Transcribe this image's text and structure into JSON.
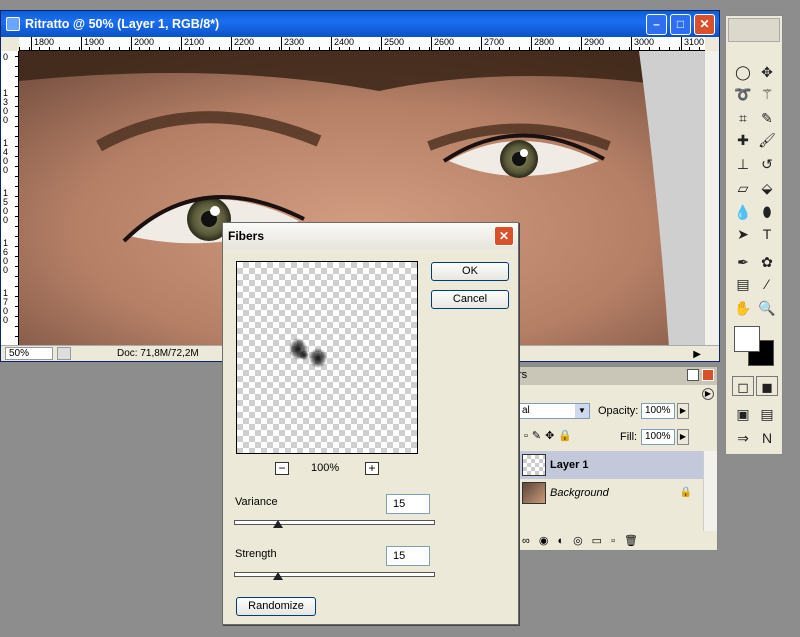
{
  "document": {
    "title": "Ritratto @ 50% (Layer 1, RGB/8*)",
    "ruler_top": [
      "1800",
      "1900",
      "2000",
      "2100",
      "2200",
      "2300",
      "2400",
      "2500",
      "2600",
      "2700",
      "2800",
      "2900",
      "3000",
      "3100"
    ],
    "ruler_left": [
      "0",
      "1 3 0 0",
      "1 4 0 0",
      "1 5 0 0",
      "1 6 0 0",
      "1 7 0 0"
    ],
    "zoom": "50%",
    "doc_info": "Doc: 71,8M/72,2M"
  },
  "dialog": {
    "title": "Fibers",
    "ok": "OK",
    "cancel": "Cancel",
    "zoom": "100%",
    "zoom_out": "−",
    "zoom_in": "+",
    "variance_label": "Variance",
    "variance_value": "15",
    "strength_label": "Strength",
    "strength_value": "15",
    "randomize": "Randomize",
    "variance_slider_fraction": 0.22,
    "strength_slider_fraction": 0.22
  },
  "layers_panel": {
    "tab_fragment": "rs",
    "blend_fragment": "al",
    "opacity_label": "Opacity:",
    "opacity_value": "100%",
    "fill_label": "Fill:",
    "fill_value": "100%",
    "layers": [
      {
        "name": "Layer 1",
        "selected": true
      },
      {
        "name": "Background",
        "selected": false
      }
    ]
  },
  "tools_panel": {
    "icons": [
      "marquee-ellipse",
      "move",
      "lasso",
      "magic-wand",
      "crop",
      "slice",
      "healing-brush",
      "brush",
      "clone-stamp",
      "history-brush",
      "eraser",
      "paint-bucket",
      "blur",
      "sponge",
      "path-selection",
      "type",
      "pen",
      "custom-shape",
      "notes",
      "eyedropper",
      "hand",
      "zoom"
    ]
  },
  "colors": {
    "title_blue": "#1c6ef2",
    "close_red": "#d9502b",
    "panel_bg": "#ece9d8",
    "desktop_gray": "#8d8d8d"
  }
}
